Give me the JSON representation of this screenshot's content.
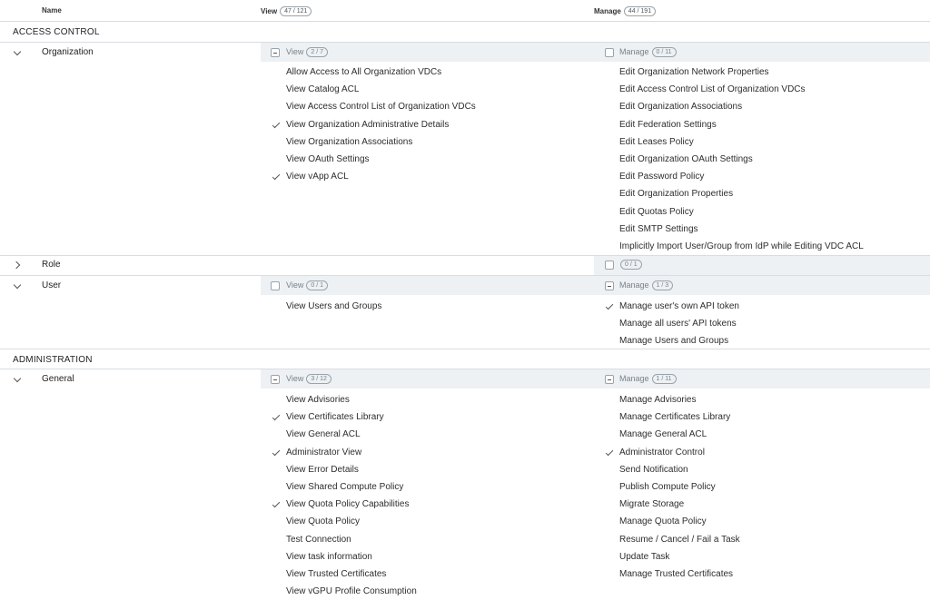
{
  "header": {
    "name_label": "Name",
    "view_label": "View",
    "view_count": "47 / 121",
    "manage_label": "Manage",
    "manage_count": "44 / 191"
  },
  "sections": {
    "access_control": "ACCESS CONTROL",
    "administration": "ADMINISTRATION"
  },
  "organization": {
    "name": "Organization",
    "view_label": "View",
    "view_count": "2 / 7",
    "manage_label": "Manage",
    "manage_count": "0 / 11",
    "view_items": [
      {
        "label": "Allow Access to All Organization VDCs",
        "checked": false
      },
      {
        "label": "View Catalog ACL",
        "checked": false
      },
      {
        "label": "View Access Control List of Organization VDCs",
        "checked": false
      },
      {
        "label": "View Organization Administrative Details",
        "checked": true
      },
      {
        "label": "View Organization Associations",
        "checked": false
      },
      {
        "label": "View OAuth Settings",
        "checked": false
      },
      {
        "label": "View vApp ACL",
        "checked": true
      }
    ],
    "manage_items": [
      {
        "label": "Edit Organization Network Properties",
        "checked": false
      },
      {
        "label": "Edit Access Control List of Organization VDCs",
        "checked": false
      },
      {
        "label": "Edit Organization Associations",
        "checked": false
      },
      {
        "label": "Edit Federation Settings",
        "checked": false
      },
      {
        "label": "Edit Leases Policy",
        "checked": false
      },
      {
        "label": "Edit Organization OAuth Settings",
        "checked": false
      },
      {
        "label": "Edit Password Policy",
        "checked": false
      },
      {
        "label": "Edit Organization Properties",
        "checked": false
      },
      {
        "label": "Edit Quotas Policy",
        "checked": false
      },
      {
        "label": "Edit SMTP Settings",
        "checked": false
      },
      {
        "label": "Implicitly Import User/Group from IdP while Editing VDC ACL",
        "checked": false
      }
    ]
  },
  "role": {
    "name": "Role",
    "manage_count": "0 / 1"
  },
  "user": {
    "name": "User",
    "view_label": "View",
    "view_count": "0 / 1",
    "manage_label": "Manage",
    "manage_count": "1 / 3",
    "view_items": [
      {
        "label": "View Users and Groups",
        "checked": false
      }
    ],
    "manage_items": [
      {
        "label": "Manage user's own API token",
        "checked": true
      },
      {
        "label": "Manage all users' API tokens",
        "checked": false
      },
      {
        "label": "Manage Users and Groups",
        "checked": false
      }
    ]
  },
  "general": {
    "name": "General",
    "view_label": "View",
    "view_count": "3 / 12",
    "manage_label": "Manage",
    "manage_count": "1 / 11",
    "view_items": [
      {
        "label": "View Advisories",
        "checked": false
      },
      {
        "label": "View Certificates Library",
        "checked": true
      },
      {
        "label": "View General ACL",
        "checked": false
      },
      {
        "label": "Administrator View",
        "checked": true
      },
      {
        "label": "View Error Details",
        "checked": false
      },
      {
        "label": "View Shared Compute Policy",
        "checked": false
      },
      {
        "label": "View Quota Policy Capabilities",
        "checked": true
      },
      {
        "label": "View Quota Policy",
        "checked": false
      },
      {
        "label": "Test Connection",
        "checked": false
      },
      {
        "label": "View task information",
        "checked": false
      },
      {
        "label": "View Trusted Certificates",
        "checked": false
      },
      {
        "label": "View vGPU Profile Consumption",
        "checked": false
      }
    ],
    "manage_items": [
      {
        "label": "Manage Advisories",
        "checked": false
      },
      {
        "label": "Manage Certificates Library",
        "checked": false
      },
      {
        "label": "Manage General ACL",
        "checked": false
      },
      {
        "label": "Administrator Control",
        "checked": true
      },
      {
        "label": "Send Notification",
        "checked": false
      },
      {
        "label": "Publish Compute Policy",
        "checked": false
      },
      {
        "label": "Migrate Storage",
        "checked": false
      },
      {
        "label": "Manage Quota Policy",
        "checked": false
      },
      {
        "label": "Resume / Cancel / Fail a Task",
        "checked": false
      },
      {
        "label": "Update Task",
        "checked": false
      },
      {
        "label": "Manage Trusted Certificates",
        "checked": false
      }
    ]
  }
}
